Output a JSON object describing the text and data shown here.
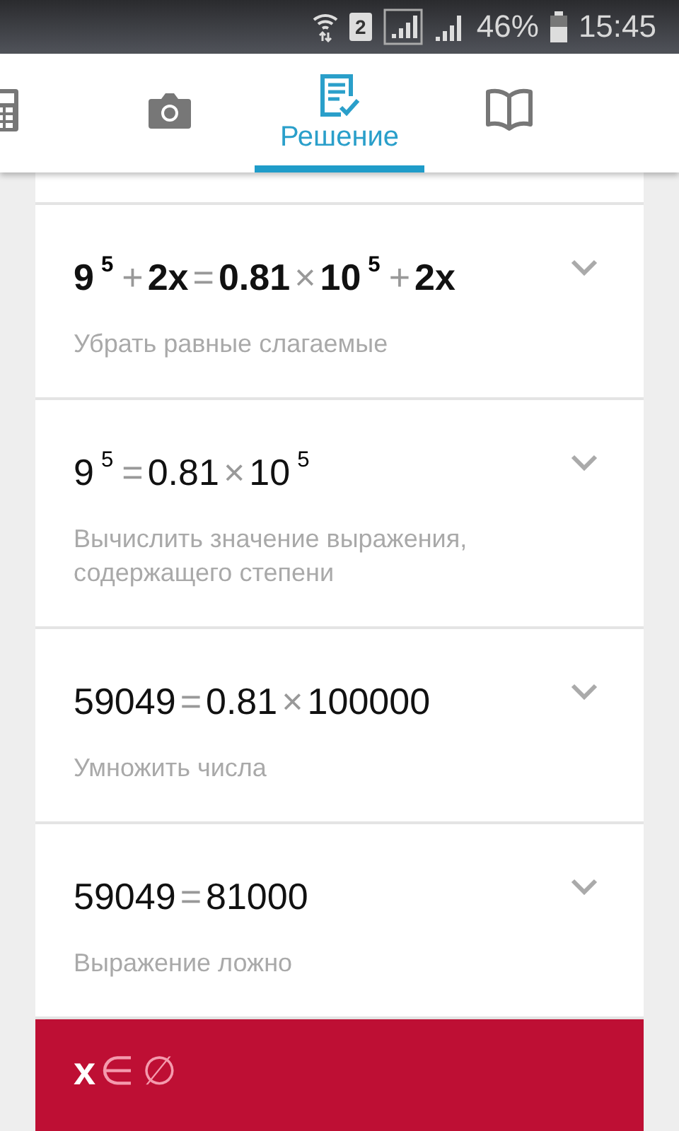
{
  "status_bar": {
    "sim": "2",
    "battery_percent": "46%",
    "time": "15:45"
  },
  "tabs": [
    {
      "kind": "calculator",
      "selected": false
    },
    {
      "kind": "camera",
      "selected": false
    },
    {
      "kind": "solution",
      "label": "Решение",
      "selected": true
    },
    {
      "kind": "book",
      "selected": false
    }
  ],
  "steps": [
    {
      "equation": [
        {
          "kind": "term",
          "text": "9"
        },
        {
          "kind": "power",
          "text": "5"
        },
        {
          "kind": "op",
          "text": "+"
        },
        {
          "kind": "term",
          "text": "2x"
        },
        {
          "kind": "op",
          "text": "="
        },
        {
          "kind": "term",
          "text": "0.81"
        },
        {
          "kind": "op",
          "text": "×"
        },
        {
          "kind": "term",
          "text": "10"
        },
        {
          "kind": "power",
          "text": "5"
        },
        {
          "kind": "op",
          "text": "+"
        },
        {
          "kind": "term",
          "text": "2x"
        }
      ],
      "bold": true,
      "description": "Убрать равные слагаемые",
      "expanded": false
    },
    {
      "equation": [
        {
          "kind": "term",
          "text": "9"
        },
        {
          "kind": "power",
          "text": "5"
        },
        {
          "kind": "op",
          "text": "="
        },
        {
          "kind": "term",
          "text": "0.81"
        },
        {
          "kind": "op",
          "text": "×"
        },
        {
          "kind": "term",
          "text": "10"
        },
        {
          "kind": "power",
          "text": "5"
        }
      ],
      "bold": false,
      "description": "Вычислить значение выражения, содержащего степени",
      "expanded": false
    },
    {
      "equation": [
        {
          "kind": "term",
          "text": "59049"
        },
        {
          "kind": "op",
          "text": "="
        },
        {
          "kind": "term",
          "text": "0.81"
        },
        {
          "kind": "op",
          "text": "×"
        },
        {
          "kind": "term",
          "text": "100000"
        }
      ],
      "bold": false,
      "description": "Умножить числа",
      "expanded": false
    },
    {
      "equation": [
        {
          "kind": "term",
          "text": "59049"
        },
        {
          "kind": "op",
          "text": "="
        },
        {
          "kind": "term",
          "text": "81000"
        }
      ],
      "bold": false,
      "description": "Выражение ложно",
      "expanded": false
    }
  ],
  "answer": [
    {
      "kind": "term",
      "text": "x"
    },
    {
      "kind": "op",
      "text": "∈"
    },
    {
      "kind": "op",
      "text": "∅"
    }
  ]
}
